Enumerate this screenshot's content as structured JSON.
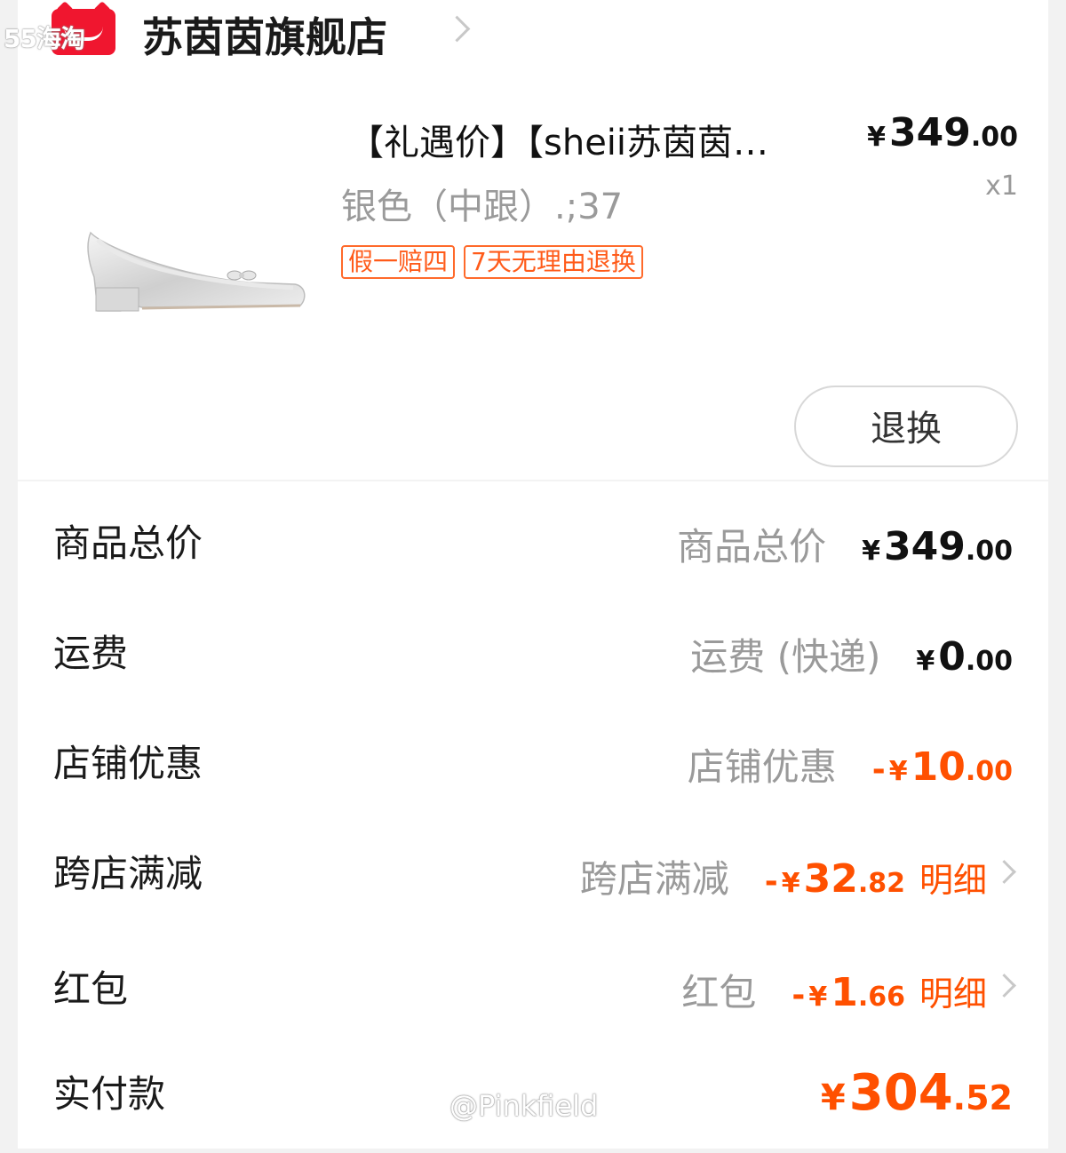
{
  "watermark_top": "55海淘",
  "shop": {
    "name": "苏茵茵旗舰店"
  },
  "product": {
    "title": "【礼遇价】【sheii苏茵茵…",
    "price_yen": "¥",
    "price_int": "349",
    "price_dec": ".00",
    "quantity": "x1",
    "sku": "银色（中跟）.;37",
    "tags": [
      "假一赔四",
      "7天无理由退换"
    ],
    "return_button": "退换"
  },
  "rows": [
    {
      "label": "商品总价",
      "sub": "商品总价",
      "sign": "",
      "yen": "¥",
      "int": "349",
      "dec": ".00"
    },
    {
      "label": "运费",
      "sub": "运费 (快递)",
      "sign": "",
      "yen": "¥",
      "int": "0",
      "dec": ".00"
    },
    {
      "label": "店铺优惠",
      "sub": "店铺优惠",
      "sign": "-",
      "yen": "¥",
      "int": "10",
      "dec": ".00"
    },
    {
      "label": "跨店满减",
      "sub": "跨店满减",
      "sign": "-",
      "yen": "¥",
      "int": "32",
      "dec": ".82",
      "detail": "明细"
    },
    {
      "label": "红包",
      "sub": "红包",
      "sign": "-",
      "yen": "¥",
      "int": "1",
      "dec": ".66",
      "detail": "明细"
    }
  ],
  "total": {
    "label": "实付款",
    "yen": "¥",
    "int": "304",
    "dec": ".52"
  },
  "watermark_bottom": "@Pinkfield",
  "colors": {
    "accent": "#ff5000",
    "brand_red": "#f0162f",
    "muted": "#9a9a9a"
  }
}
